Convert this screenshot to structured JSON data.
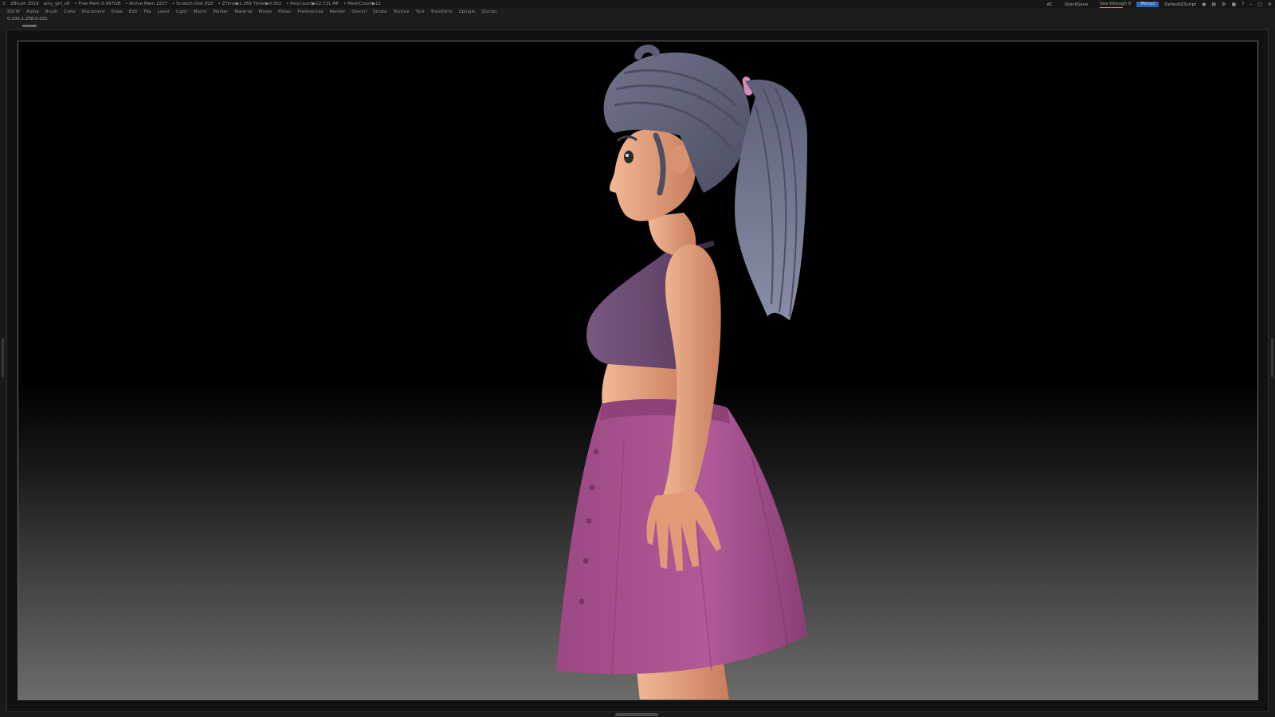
{
  "titlebar": {
    "app_name": "ZBrush 2019",
    "document_name": "amy_girl_v8",
    "free_mem": "• Free Mem 0.997GB",
    "active_mem": "• Active Mem 2227",
    "scratch_disk": "• Scratch Disk 820",
    "ztime": "• ZTime▶1.269 Timer▶0.002",
    "polycount": "• PolyCount▶12.711 MP",
    "meshcount": "• MeshCount▶11",
    "ac": "AC",
    "quicksave": "QuickSave",
    "see_through": "See-through 0",
    "menus": "Menus",
    "default_zscript": "DefaultZScript"
  },
  "menubar": {
    "items": [
      "3DCW",
      "Alpha",
      "Brush",
      "Color",
      "Document",
      "Draw",
      "Edit",
      "File",
      "Layer",
      "Light",
      "Macro",
      "Marker",
      "Material",
      "Movie",
      "Picker",
      "Preferences",
      "Render",
      "Stencil",
      "Stroke",
      "Texture",
      "Tool",
      "Transform",
      "Zplugin",
      "Zscript"
    ]
  },
  "infobar": {
    "coords": "0.106,1.258,0.021"
  },
  "colors": {
    "skin": "#e6a480",
    "skin_shadow": "#c97e5e",
    "hair": "#6a6d82",
    "hair_dark": "#4c4f63",
    "top": "#6c4a70",
    "skirt": "#a8508e",
    "skirt_dark": "#7c3a6c",
    "hair_tie": "#d88ab8",
    "menu_accent": "#2b64b0"
  },
  "icons": [
    "camera-icon",
    "layout-icon",
    "lock-icon",
    "help-icon",
    "minimize-icon",
    "maximize-icon",
    "close-icon"
  ]
}
